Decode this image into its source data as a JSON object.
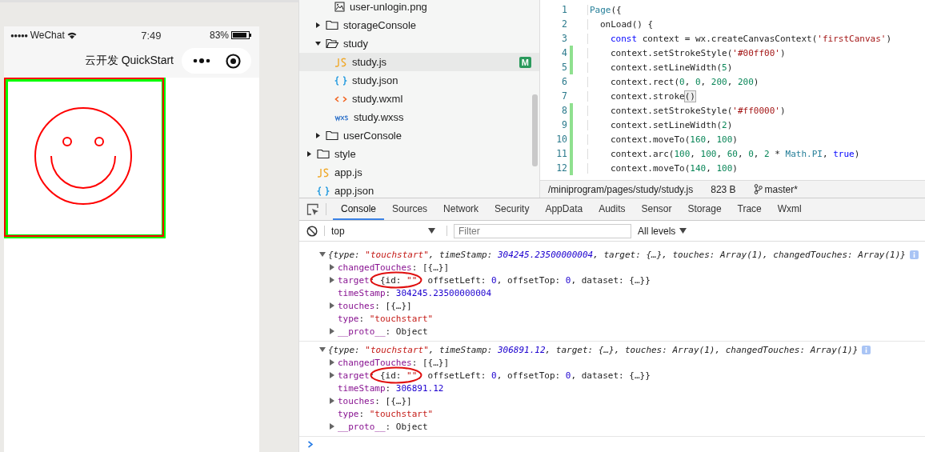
{
  "simulator": {
    "status_bar": {
      "signal": "●●●●●",
      "carrier": "WeChat",
      "time": "7:49",
      "battery": "83%"
    },
    "nav_title": "云开发 QuickStart"
  },
  "file_tree": [
    {
      "kind": "cut",
      "children": [
        {
          "kind": "cut",
          "children": [
            {
              "label": "user-unlogin.png",
              "kind": "image",
              "selected": false
            }
          ]
        },
        {
          "label": "storageConsole",
          "kind": "folder",
          "expanded": false
        },
        {
          "label": "study",
          "kind": "folder",
          "expanded": true,
          "children": [
            {
              "label": "study.js",
              "kind": "js",
              "selected": true,
              "badge": "M"
            },
            {
              "label": "study.json",
              "kind": "json",
              "selected": false
            },
            {
              "label": "study.wxml",
              "kind": "wxml",
              "selected": false
            },
            {
              "label": "study.wxss",
              "kind": "wxss",
              "selected": false
            }
          ]
        },
        {
          "label": "userConsole",
          "kind": "folder",
          "expanded": false
        }
      ]
    },
    {
      "label": "style",
      "kind": "folder",
      "expanded": false
    },
    {
      "label": "app.js",
      "kind": "js",
      "selected": false
    },
    {
      "label": "app.json",
      "kind": "json",
      "selected": false
    }
  ],
  "editor": {
    "lines": [
      {
        "number": "1",
        "modified": false,
        "tokens": [
          {
            "kind": "type",
            "text": "Page"
          },
          {
            "kind": "plain",
            "text": "({"
          }
        ],
        "children": [
          {
            "number": "2",
            "modified": false,
            "tokens": [
              {
                "kind": "plain",
                "text": "onLoad() {"
              }
            ],
            "children": [
              {
                "number": "3",
                "modified": false,
                "tokens": [
                  {
                    "kind": "kw",
                    "text": "const"
                  },
                  {
                    "kind": "plain",
                    "text": " context = wx.createCanvasContext("
                  },
                  {
                    "kind": "str",
                    "text": "'firstCanvas'"
                  },
                  {
                    "kind": "plain",
                    "text": ")"
                  }
                ]
              },
              {
                "number": "4",
                "modified": true,
                "tokens": [
                  {
                    "kind": "plain",
                    "text": "context.setStrokeStyle("
                  },
                  {
                    "kind": "str",
                    "text": "'#00ff00'"
                  },
                  {
                    "kind": "plain",
                    "text": ")"
                  }
                ]
              },
              {
                "number": "5",
                "modified": true,
                "tokens": [
                  {
                    "kind": "plain",
                    "text": "context.setLineWidth("
                  },
                  {
                    "kind": "num",
                    "text": "5"
                  },
                  {
                    "kind": "plain",
                    "text": ")"
                  }
                ]
              },
              {
                "number": "6",
                "modified": false,
                "tokens": [
                  {
                    "kind": "plain",
                    "text": "context.rect("
                  },
                  {
                    "kind": "num",
                    "text": "0"
                  },
                  {
                    "kind": "plain",
                    "text": ", "
                  },
                  {
                    "kind": "num",
                    "text": "0"
                  },
                  {
                    "kind": "plain",
                    "text": ", "
                  },
                  {
                    "kind": "num",
                    "text": "200"
                  },
                  {
                    "kind": "plain",
                    "text": ", "
                  },
                  {
                    "kind": "num",
                    "text": "200"
                  },
                  {
                    "kind": "plain",
                    "text": ")"
                  }
                ]
              },
              {
                "number": "7",
                "modified": false,
                "tokens": [
                  {
                    "kind": "plain",
                    "text": "context.stroke"
                  },
                  {
                    "kind": "match",
                    "text": "()"
                  }
                ]
              },
              {
                "number": "8",
                "modified": true,
                "tokens": [
                  {
                    "kind": "plain",
                    "text": "context.setStrokeStyle("
                  },
                  {
                    "kind": "str",
                    "text": "'#ff0000'"
                  },
                  {
                    "kind": "plain",
                    "text": ")"
                  }
                ]
              },
              {
                "number": "9",
                "modified": true,
                "tokens": [
                  {
                    "kind": "plain",
                    "text": "context.setLineWidth("
                  },
                  {
                    "kind": "num",
                    "text": "2"
                  },
                  {
                    "kind": "plain",
                    "text": ")"
                  }
                ]
              },
              {
                "number": "10",
                "modified": true,
                "tokens": [
                  {
                    "kind": "plain",
                    "text": "context.moveTo("
                  },
                  {
                    "kind": "num",
                    "text": "160"
                  },
                  {
                    "kind": "plain",
                    "text": ", "
                  },
                  {
                    "kind": "num",
                    "text": "100"
                  },
                  {
                    "kind": "plain",
                    "text": ")"
                  }
                ]
              },
              {
                "number": "11",
                "modified": true,
                "tokens": [
                  {
                    "kind": "plain",
                    "text": "context.arc("
                  },
                  {
                    "kind": "num",
                    "text": "100"
                  },
                  {
                    "kind": "plain",
                    "text": ", "
                  },
                  {
                    "kind": "num",
                    "text": "100"
                  },
                  {
                    "kind": "plain",
                    "text": ", "
                  },
                  {
                    "kind": "num",
                    "text": "60"
                  },
                  {
                    "kind": "plain",
                    "text": ", "
                  },
                  {
                    "kind": "num",
                    "text": "0"
                  },
                  {
                    "kind": "plain",
                    "text": ", "
                  },
                  {
                    "kind": "num",
                    "text": "2"
                  },
                  {
                    "kind": "plain",
                    "text": " * "
                  },
                  {
                    "kind": "type",
                    "text": "Math.PI"
                  },
                  {
                    "kind": "plain",
                    "text": ", "
                  },
                  {
                    "kind": "kw",
                    "text": "true"
                  },
                  {
                    "kind": "plain",
                    "text": ")"
                  }
                ]
              },
              {
                "number": "12",
                "modified": true,
                "tokens": [
                  {
                    "kind": "plain",
                    "text": "context.moveTo("
                  },
                  {
                    "kind": "num",
                    "text": "140"
                  },
                  {
                    "kind": "plain",
                    "text": ", "
                  },
                  {
                    "kind": "num",
                    "text": "100"
                  },
                  {
                    "kind": "plain",
                    "text": ")"
                  }
                ]
              }
            ]
          }
        ]
      }
    ],
    "status": {
      "path": "/miniprogram/pages/study/study.js",
      "size": "823 B",
      "branch": "master*"
    }
  },
  "devtools": {
    "tabs": [
      {
        "label": "Console",
        "selected": true
      },
      {
        "label": "Sources",
        "selected": false
      },
      {
        "label": "Network",
        "selected": false
      },
      {
        "label": "Security",
        "selected": false
      },
      {
        "label": "AppData",
        "selected": false
      },
      {
        "label": "Audits",
        "selected": false
      },
      {
        "label": "Sensor",
        "selected": false
      },
      {
        "label": "Storage",
        "selected": false
      },
      {
        "label": "Trace",
        "selected": false
      },
      {
        "label": "Wxml",
        "selected": false
      }
    ],
    "context": "top",
    "filter": {
      "placeholder": "Filter"
    },
    "levels": "All levels",
    "entries": [
      {
        "expanded": true,
        "summary": [
          {
            "kind": "plain",
            "text": "{type: "
          },
          {
            "kind": "str",
            "text": "\"touchstart\""
          },
          {
            "kind": "plain",
            "text": ", timeStamp: "
          },
          {
            "kind": "num",
            "text": "304245.23500000004"
          },
          {
            "kind": "plain",
            "text": ", target: {…}, touches: Array(1), changedTouches: Array(1)}"
          }
        ],
        "children": [
          {
            "expandable": true,
            "circled": false,
            "tokens": [
              {
                "kind": "key",
                "text": "changedTouches"
              },
              {
                "kind": "plain",
                "text": ": [{…}]"
              }
            ]
          },
          {
            "expandable": true,
            "circled": true,
            "tokens": [
              {
                "kind": "key",
                "text": "target"
              },
              {
                "kind": "plain",
                "text": ": {id: "
              },
              {
                "kind": "str",
                "text": "\"\""
              },
              {
                "kind": "plain",
                "text": ", offsetLeft: "
              },
              {
                "kind": "num",
                "text": "0"
              },
              {
                "kind": "plain",
                "text": ", offsetTop: "
              },
              {
                "kind": "num",
                "text": "0"
              },
              {
                "kind": "plain",
                "text": ", dataset: {…}}"
              }
            ]
          },
          {
            "expandable": false,
            "circled": false,
            "tokens": [
              {
                "kind": "key",
                "text": "timeStamp"
              },
              {
                "kind": "plain",
                "text": ": "
              },
              {
                "kind": "num",
                "text": "304245.23500000004"
              }
            ]
          },
          {
            "expandable": true,
            "circled": false,
            "tokens": [
              {
                "kind": "key",
                "text": "touches"
              },
              {
                "kind": "plain",
                "text": ": [{…}]"
              }
            ]
          },
          {
            "expandable": false,
            "circled": false,
            "tokens": [
              {
                "kind": "key",
                "text": "type"
              },
              {
                "kind": "plain",
                "text": ": "
              },
              {
                "kind": "str",
                "text": "\"touchstart\""
              }
            ]
          },
          {
            "expandable": true,
            "circled": false,
            "tokens": [
              {
                "kind": "proto",
                "text": "__proto__"
              },
              {
                "kind": "plain",
                "text": ": Object"
              }
            ]
          }
        ]
      },
      {
        "expanded": true,
        "summary": [
          {
            "kind": "plain",
            "text": "{type: "
          },
          {
            "kind": "str",
            "text": "\"touchstart\""
          },
          {
            "kind": "plain",
            "text": ", timeStamp: "
          },
          {
            "kind": "num",
            "text": "306891.12"
          },
          {
            "kind": "plain",
            "text": ", target: {…}, touches: Array(1), changedTouches: Array(1)}"
          }
        ],
        "children": [
          {
            "expandable": true,
            "circled": false,
            "tokens": [
              {
                "kind": "key",
                "text": "changedTouches"
              },
              {
                "kind": "plain",
                "text": ": [{…}]"
              }
            ]
          },
          {
            "expandable": true,
            "circled": true,
            "tokens": [
              {
                "kind": "key",
                "text": "target"
              },
              {
                "kind": "plain",
                "text": ": {id: "
              },
              {
                "kind": "str",
                "text": "\"\""
              },
              {
                "kind": "plain",
                "text": ", offsetLeft: "
              },
              {
                "kind": "num",
                "text": "0"
              },
              {
                "kind": "plain",
                "text": ", offsetTop: "
              },
              {
                "kind": "num",
                "text": "0"
              },
              {
                "kind": "plain",
                "text": ", dataset: {…}}"
              }
            ]
          },
          {
            "expandable": false,
            "circled": false,
            "tokens": [
              {
                "kind": "key",
                "text": "timeStamp"
              },
              {
                "kind": "plain",
                "text": ": "
              },
              {
                "kind": "num",
                "text": "306891.12"
              }
            ]
          },
          {
            "expandable": true,
            "circled": false,
            "tokens": [
              {
                "kind": "key",
                "text": "touches"
              },
              {
                "kind": "plain",
                "text": ": [{…}]"
              }
            ]
          },
          {
            "expandable": false,
            "circled": false,
            "tokens": [
              {
                "kind": "key",
                "text": "type"
              },
              {
                "kind": "plain",
                "text": ": "
              },
              {
                "kind": "str",
                "text": "\"touchstart\""
              }
            ]
          },
          {
            "expandable": true,
            "circled": false,
            "tokens": [
              {
                "kind": "proto",
                "text": "__proto__"
              },
              {
                "kind": "plain",
                "text": ": Object"
              }
            ]
          }
        ]
      }
    ]
  }
}
